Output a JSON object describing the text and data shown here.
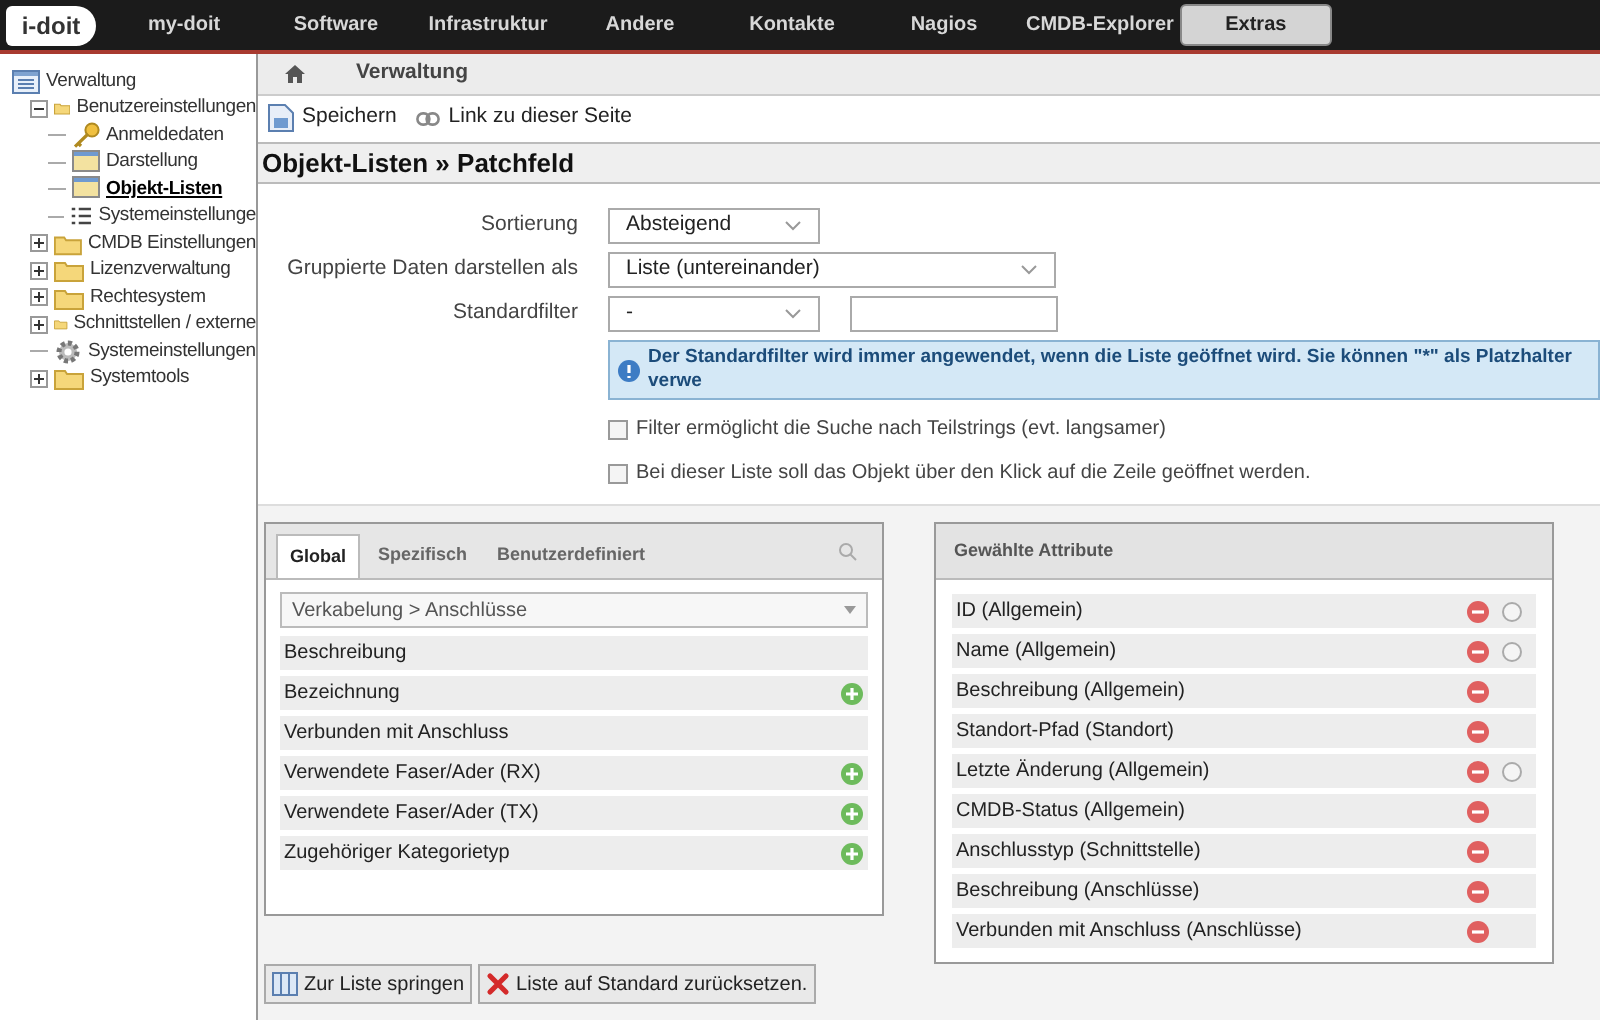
{
  "nav": {
    "logo": "i-doit",
    "items": [
      {
        "label": "my-doit",
        "selected": false
      },
      {
        "label": "Software",
        "selected": false
      },
      {
        "label": "Infrastruktur",
        "selected": false
      },
      {
        "label": "Andere",
        "selected": false
      },
      {
        "label": "Kontakte",
        "selected": false
      },
      {
        "label": "Nagios",
        "selected": false
      },
      {
        "label": "CMDB-Explorer",
        "selected": false
      },
      {
        "label": "Extras",
        "selected": true
      }
    ]
  },
  "sidebar": {
    "tree": [
      {
        "label": "Verwaltung",
        "kind": "root",
        "selected": false,
        "children": [
          {
            "label": "Benutzereinstellungen",
            "kind": "folder",
            "expanded": true,
            "selected": false,
            "children": [
              {
                "label": "Anmeldedaten",
                "kind": "key",
                "selected": false
              },
              {
                "label": "Darstellung",
                "kind": "display",
                "selected": false
              },
              {
                "label": "Objekt-Listen",
                "kind": "display",
                "selected": true
              },
              {
                "label": "Systemeinstellunge",
                "kind": "list",
                "selected": false
              }
            ]
          },
          {
            "label": "CMDB Einstellungen",
            "kind": "folder",
            "expanded": false,
            "selected": false
          },
          {
            "label": "Lizenzverwaltung",
            "kind": "folder",
            "expanded": false,
            "selected": false
          },
          {
            "label": "Rechtesystem",
            "kind": "folder",
            "expanded": false,
            "selected": false
          },
          {
            "label": "Schnittstellen / externe",
            "kind": "folder",
            "expanded": false,
            "selected": false
          },
          {
            "label": "Systemeinstellungen",
            "kind": "gear",
            "selected": false
          },
          {
            "label": "Systemtools",
            "kind": "folder",
            "expanded": false,
            "selected": false
          }
        ]
      }
    ]
  },
  "breadcrumb": [
    "Verwaltung"
  ],
  "toolbar": [
    {
      "label": "Speichern",
      "kind": "save"
    },
    {
      "label": "Link zu dieser Seite",
      "kind": "link"
    }
  ],
  "title": "Objekt-Listen » Patchfeld",
  "form": {
    "fields": [
      {
        "label": "Sortierung",
        "kind": "select",
        "value": "Absteigend"
      },
      {
        "label": "Gruppierte Daten darstellen als",
        "kind": "select-wide",
        "value": "Liste (untereinander)"
      },
      {
        "label": "Standardfilter",
        "kind": "select-input",
        "value": "-"
      }
    ],
    "info": "Der Standardfilter wird immer angewendet, wenn die Liste geöffnet wird. Sie können \"*\" als Platzhalter verwe",
    "checkboxes": [
      {
        "label": "Filter ermöglicht die Suche nach Teilstrings (evt. langsamer)",
        "checked": false
      },
      {
        "label": "Bei dieser Liste soll das Objekt über den Klick auf die Zeile geöffnet werden.",
        "checked": false
      }
    ]
  },
  "available": {
    "tabs": [
      {
        "label": "Global",
        "selected": true
      },
      {
        "label": "Spezifisch",
        "selected": false
      },
      {
        "label": "Benutzerdefiniert",
        "selected": false
      }
    ],
    "category": "Verkabelung > Anschlüsse",
    "attributes": [
      {
        "label": "Beschreibung",
        "addable": false
      },
      {
        "label": "Bezeichnung",
        "addable": true
      },
      {
        "label": "Verbunden mit Anschluss",
        "addable": false
      },
      {
        "label": "Verwendete Faser/Ader (RX)",
        "addable": true
      },
      {
        "label": "Verwendete Faser/Ader (TX)",
        "addable": true
      },
      {
        "label": "Zugehöriger Kategorietyp",
        "addable": true
      }
    ]
  },
  "selected_attributes": {
    "title": "Gewählte Attribute",
    "items": [
      {
        "label": "ID (Allgemein)",
        "kind": "sortable",
        "selected": false
      },
      {
        "label": "Name (Allgemein)",
        "kind": "sortable",
        "selected": false
      },
      {
        "label": "Beschreibung (Allgemein)",
        "kind": "plain"
      },
      {
        "label": "Standort-Pfad (Standort)",
        "kind": "plain"
      },
      {
        "label": "Letzte Änderung (Allgemein)",
        "kind": "sortable",
        "selected": false
      },
      {
        "label": "CMDB-Status (Allgemein)",
        "kind": "plain"
      },
      {
        "label": "Anschlusstyp (Schnittstelle)",
        "kind": "plain"
      },
      {
        "label": "Beschreibung (Anschlüsse)",
        "kind": "plain"
      },
      {
        "label": "Verbunden mit Anschluss (Anschlüsse)",
        "kind": "plain"
      }
    ]
  },
  "footer_buttons": [
    {
      "label": "Zur Liste springen",
      "kind": "list"
    },
    {
      "label": "Liste auf Standard zurücksetzen.",
      "kind": "reset"
    }
  ]
}
